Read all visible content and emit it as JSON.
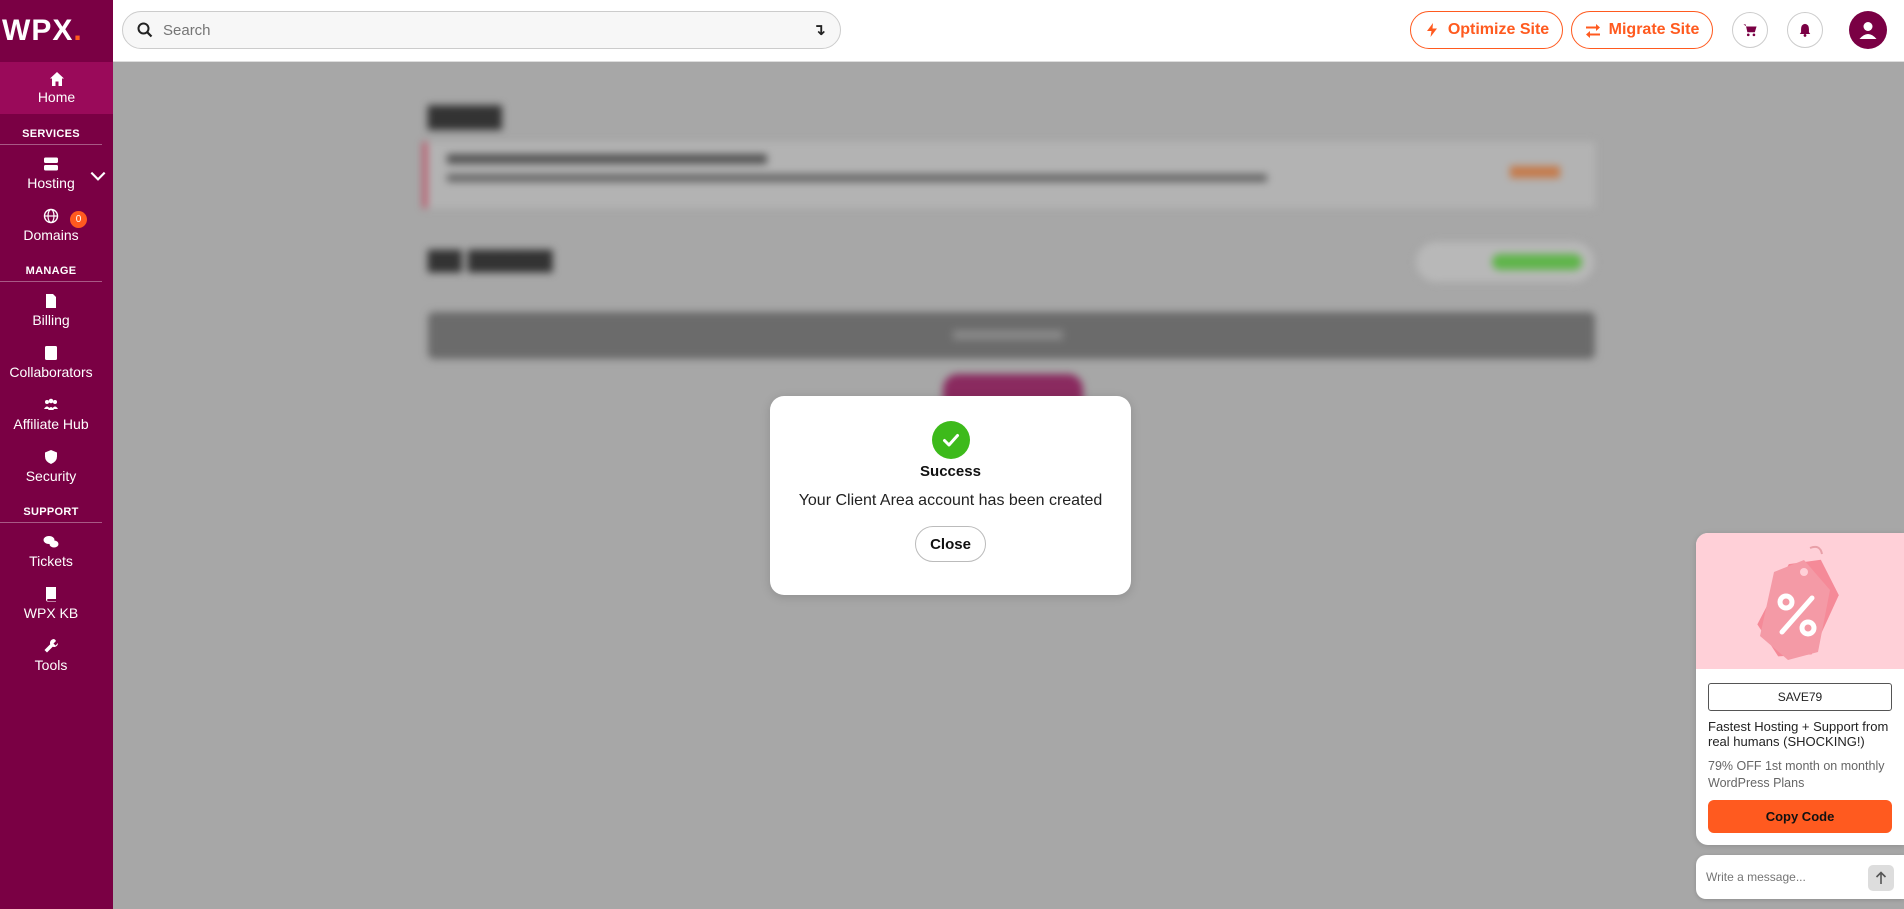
{
  "app": {
    "logo_text": "WPX",
    "logo_dot": "."
  },
  "sidebar": {
    "home_label": "Home",
    "sections": {
      "services": "SERVICES",
      "manage": "MANAGE",
      "support": "SUPPORT"
    },
    "items": {
      "hosting": "Hosting",
      "domains": "Domains",
      "domains_badge": "0",
      "billing": "Billing",
      "collaborators": "Collaborators",
      "affiliate_hub": "Affiliate Hub",
      "security": "Security",
      "tickets": "Tickets",
      "wpx_kb": "WPX KB",
      "tools": "Tools"
    }
  },
  "topbar": {
    "search_placeholder": "Search",
    "optimize_label": "Optimize Site",
    "migrate_label": "Migrate Site"
  },
  "modal": {
    "title": "Success",
    "message": "Your Client Area account has been created",
    "close_label": "Close"
  },
  "promo": {
    "code": "SAVE79",
    "headline": "Fastest Hosting + Support from real humans (SHOCKING!)",
    "subtext": "79% OFF 1st month on monthly WordPress Plans",
    "button_label": "Copy Code"
  },
  "chat": {
    "placeholder": "Write a message..."
  },
  "colors": {
    "brand": "#7a0044",
    "accent": "#ff5a1f",
    "success": "#3dba1b"
  }
}
